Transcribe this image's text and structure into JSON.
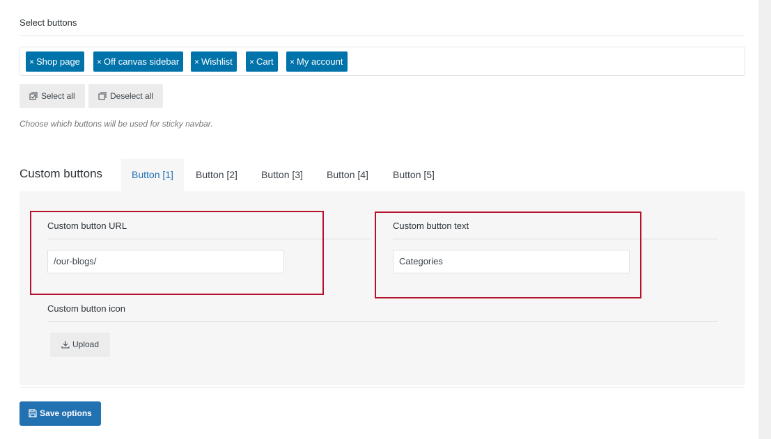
{
  "select_buttons": {
    "title": "Select buttons",
    "tags": [
      {
        "label": "Shop page",
        "remove_glyph": "×"
      },
      {
        "label": "Off canvas sidebar",
        "remove_glyph": "×"
      },
      {
        "label": "Wishlist",
        "remove_glyph": "×"
      },
      {
        "label": "Cart",
        "remove_glyph": "×"
      },
      {
        "label": "My account",
        "remove_glyph": "×"
      }
    ],
    "select_all_label": "Select all",
    "deselect_all_label": "Deselect all",
    "hint": "Choose which buttons will be used for sticky navbar."
  },
  "custom_buttons": {
    "title": "Custom buttons",
    "tabs": [
      {
        "label": "Button [1]",
        "active": true
      },
      {
        "label": "Button [2]",
        "active": false
      },
      {
        "label": "Button [3]",
        "active": false
      },
      {
        "label": "Button [4]",
        "active": false
      },
      {
        "label": "Button [5]",
        "active": false
      }
    ],
    "url_label": "Custom button URL",
    "url_value": "/our-blogs/",
    "text_label": "Custom button text",
    "text_value": "Categories",
    "icon_label": "Custom button icon",
    "upload_label": "Upload"
  },
  "save_label": "Save options",
  "colors": {
    "accent": "#2271b1",
    "tag_blue": "#0073aa",
    "highlight_red": "#b5122c"
  },
  "icons": {
    "select_all": "checkbox-check-icon",
    "deselect_all": "checkbox-empty-icon",
    "upload": "download-icon",
    "save": "floppy-disk-icon"
  }
}
